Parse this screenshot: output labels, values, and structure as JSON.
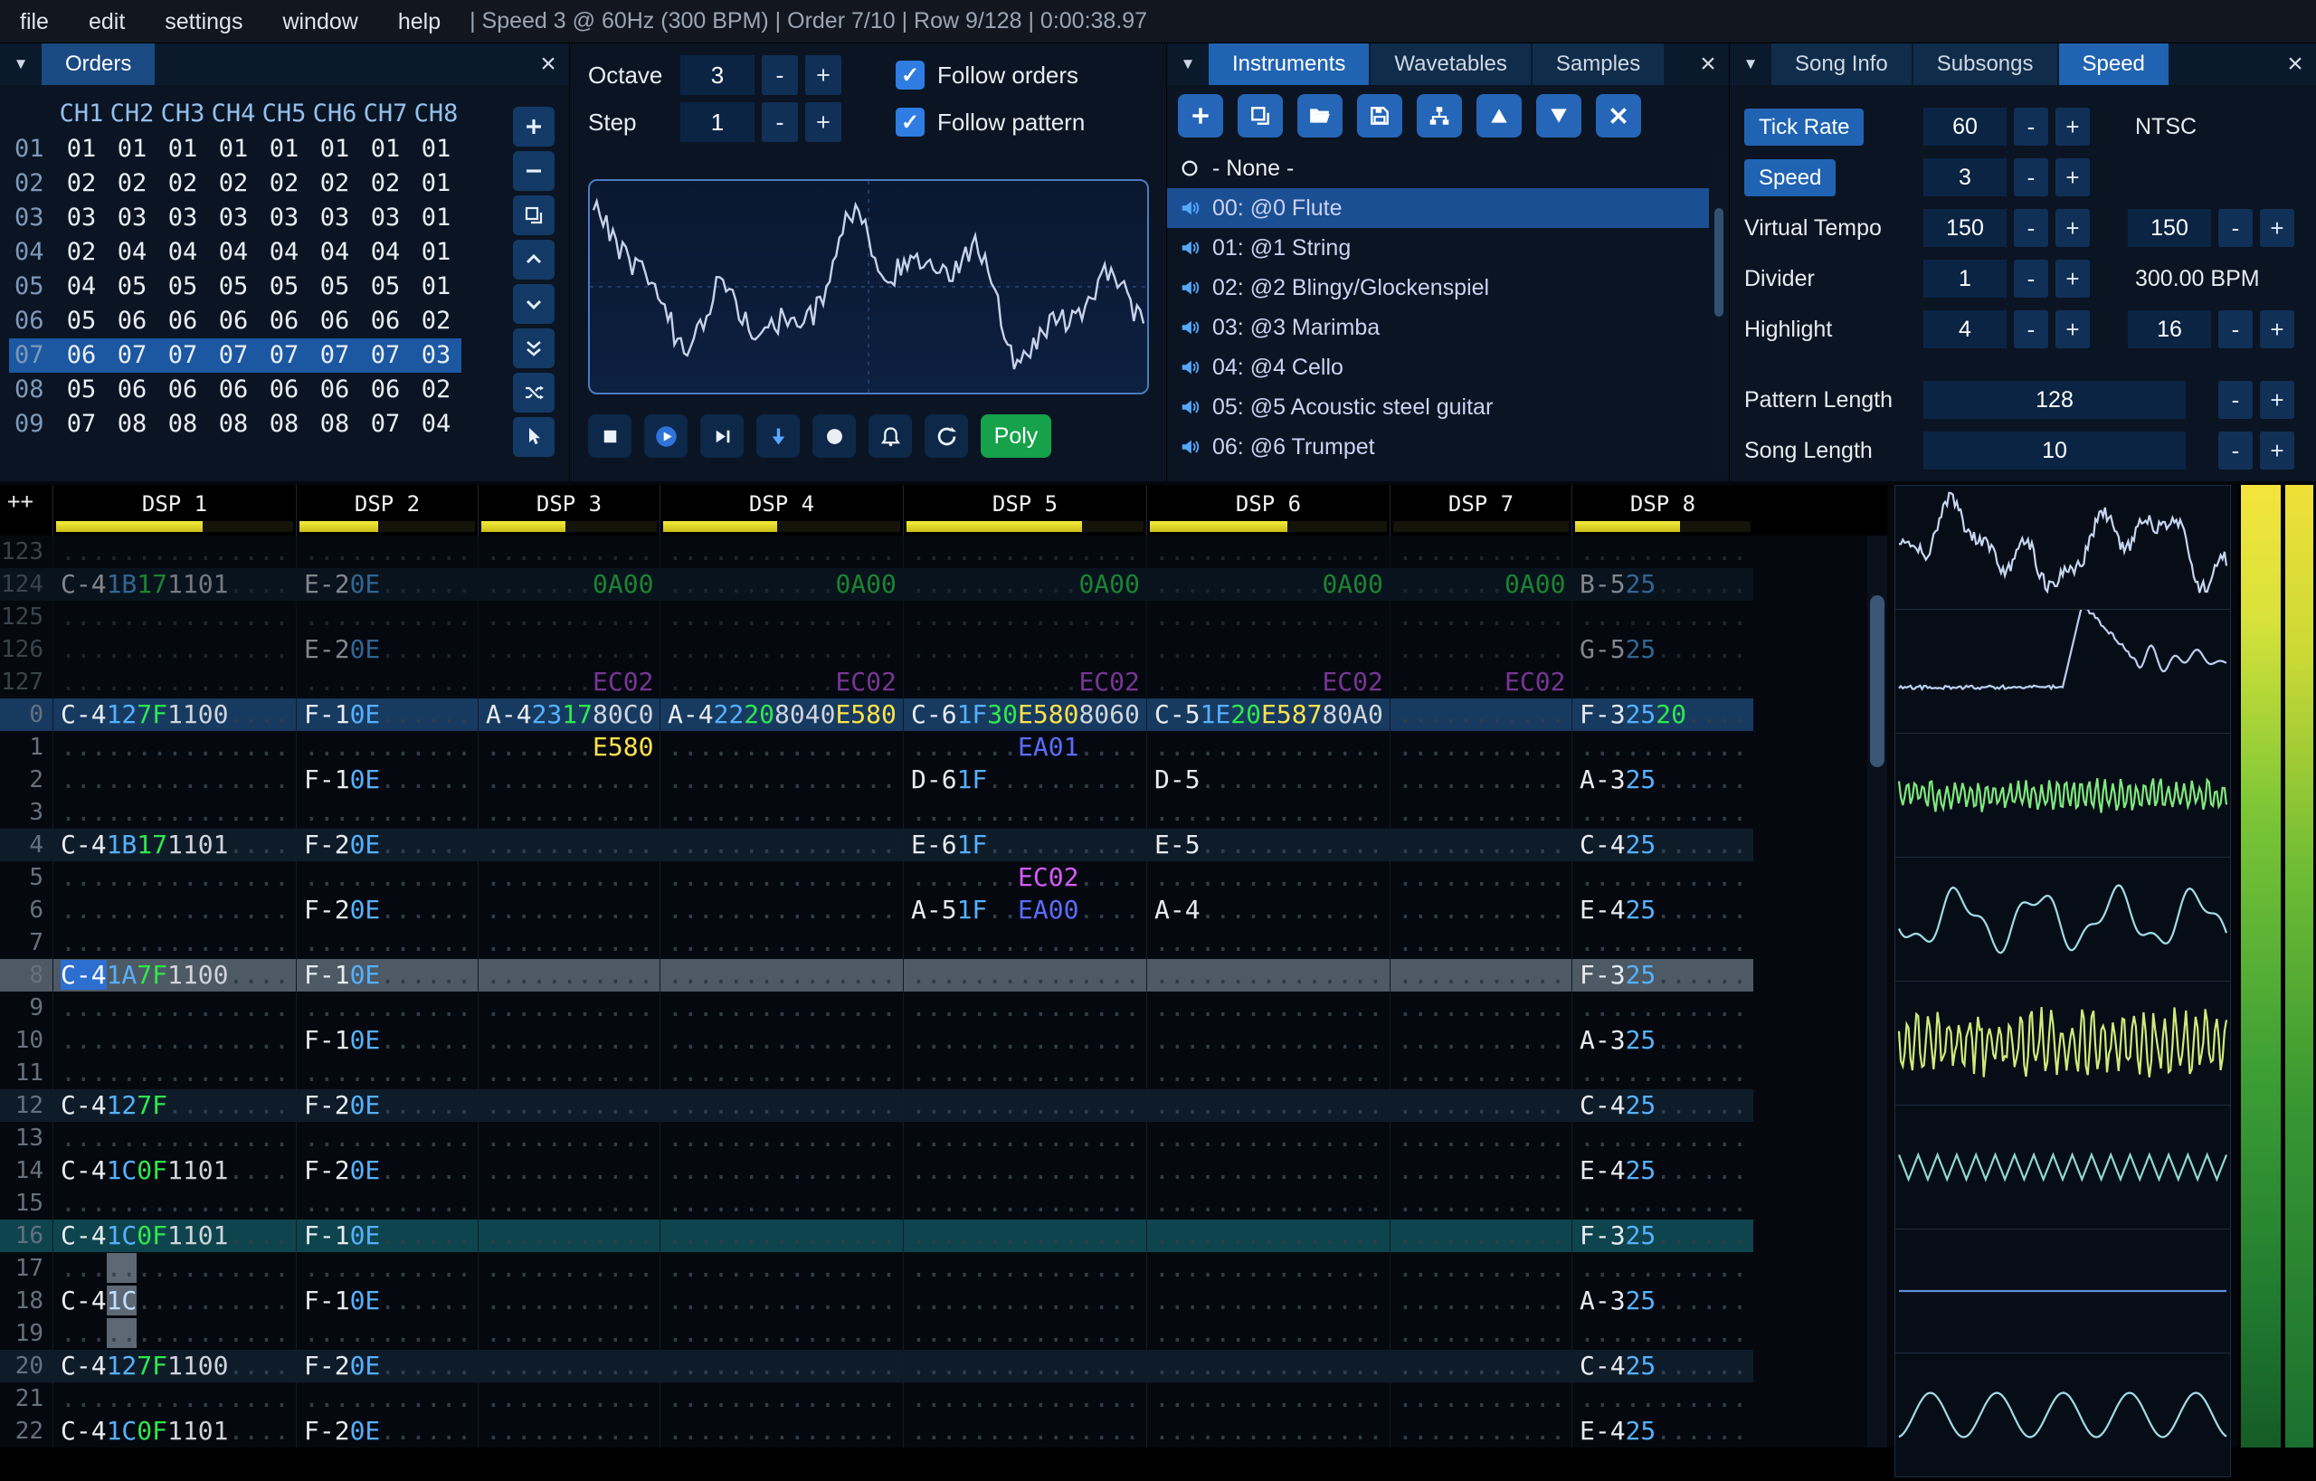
{
  "ui": {
    "collapse": "▼",
    "close": "×",
    "check": "✓"
  },
  "menu": {
    "items": [
      "file",
      "edit",
      "settings",
      "window",
      "help"
    ],
    "status": "| Speed 3 @ 60Hz (300 BPM) | Order 7/10 | Row 9/128 | 0:00:38.97"
  },
  "orders": {
    "title": "Orders",
    "columns": [
      "CH1",
      "CH2",
      "CH3",
      "CH4",
      "CH5",
      "CH6",
      "CH7",
      "CH8"
    ],
    "selected": 6,
    "rows": [
      {
        "num": "01",
        "vals": [
          "01",
          "01",
          "01",
          "01",
          "01",
          "01",
          "01",
          "01"
        ]
      },
      {
        "num": "02",
        "vals": [
          "02",
          "02",
          "02",
          "02",
          "02",
          "02",
          "02",
          "01"
        ]
      },
      {
        "num": "03",
        "vals": [
          "03",
          "03",
          "03",
          "03",
          "03",
          "03",
          "03",
          "01"
        ]
      },
      {
        "num": "04",
        "vals": [
          "02",
          "04",
          "04",
          "04",
          "04",
          "04",
          "04",
          "01"
        ]
      },
      {
        "num": "05",
        "vals": [
          "04",
          "05",
          "05",
          "05",
          "05",
          "05",
          "05",
          "01"
        ]
      },
      {
        "num": "06",
        "vals": [
          "05",
          "06",
          "06",
          "06",
          "06",
          "06",
          "06",
          "02"
        ]
      },
      {
        "num": "07",
        "vals": [
          "06",
          "07",
          "07",
          "07",
          "07",
          "07",
          "07",
          "03"
        ]
      },
      {
        "num": "08",
        "vals": [
          "05",
          "06",
          "06",
          "06",
          "06",
          "06",
          "06",
          "02"
        ]
      },
      {
        "num": "09",
        "vals": [
          "07",
          "08",
          "08",
          "08",
          "08",
          "08",
          "07",
          "04"
        ]
      }
    ],
    "toolbar": [
      "add",
      "remove",
      "duplicate",
      "move-up",
      "move-down",
      "duplicate-end",
      "random",
      "pointer"
    ]
  },
  "controls": {
    "octave_label": "Octave",
    "octave_value": "3",
    "step_label": "Step",
    "step_value": "1",
    "minus": "-",
    "plus": "+",
    "follow_orders": "Follow orders",
    "follow_pattern": "Follow pattern",
    "transport": [
      "stop",
      "play",
      "play-pattern",
      "step-down",
      "record",
      "metronome",
      "repeat"
    ],
    "poly_label": "Poly"
  },
  "oscilloscope": {
    "color": "#c6d2ea"
  },
  "instruments": {
    "tabs": [
      "Instruments",
      "Wavetables",
      "Samples"
    ],
    "active_tab": 0,
    "toolbar": [
      "add",
      "duplicate",
      "open",
      "save",
      "sitemap",
      "move-up-tri",
      "move-down-tri",
      "delete"
    ],
    "none_label": "- None -",
    "selected": 0,
    "items": [
      "00: @0 Flute",
      "01: @1 String",
      "02: @2 Blingy/Glockenspiel",
      "03: @3 Marimba",
      "04: @4 Cello",
      "05: @5 Acoustic steel guitar",
      "06: @6 Trumpet"
    ]
  },
  "song": {
    "tabs": [
      "Song Info",
      "Subsongs",
      "Speed"
    ],
    "active_tab": 2,
    "minus": "-",
    "plus": "+",
    "fields": [
      {
        "label": "Tick Rate",
        "button": true,
        "value": "60",
        "extra": "NTSC"
      },
      {
        "label": "Speed",
        "button": true,
        "value": "3"
      },
      {
        "label": "Virtual Tempo",
        "value": "150",
        "value2": "150"
      },
      {
        "label": "Divider",
        "value": "1",
        "extra": "300.00 BPM"
      },
      {
        "label": "Highlight",
        "value": "4",
        "value2": "16"
      },
      {
        "label": "Pattern Length",
        "value": "128",
        "wide": true
      },
      {
        "label": "Song Length",
        "value": "10",
        "wide": true
      }
    ]
  },
  "pattern": {
    "corner": "++",
    "channels": [
      {
        "name": "DSP 1",
        "meter": 62,
        "cols": [
          [
            "n",
            3
          ],
          [
            "i",
            2
          ],
          [
            "v",
            2
          ],
          [
            "f",
            4
          ],
          [
            "f",
            4
          ]
        ]
      },
      {
        "name": "DSP 2",
        "meter": 45,
        "cols": [
          [
            "n",
            3
          ],
          [
            "i",
            2
          ],
          [
            "v",
            2
          ],
          [
            "f",
            4
          ]
        ]
      },
      {
        "name": "DSP 3",
        "meter": 48,
        "cols": [
          [
            "n",
            3
          ],
          [
            "i",
            2
          ],
          [
            "v",
            2
          ],
          [
            "f",
            4
          ]
        ]
      },
      {
        "name": "DSP 4",
        "meter": 48,
        "cols": [
          [
            "n",
            3
          ],
          [
            "i",
            2
          ],
          [
            "v",
            2
          ],
          [
            "f",
            4
          ],
          [
            "f",
            4
          ]
        ]
      },
      {
        "name": "DSP 5",
        "meter": 74,
        "cols": [
          [
            "n",
            3
          ],
          [
            "i",
            2
          ],
          [
            "v",
            2
          ],
          [
            "f",
            4
          ],
          [
            "f",
            4
          ]
        ]
      },
      {
        "name": "DSP 6",
        "meter": 58,
        "cols": [
          [
            "n",
            3
          ],
          [
            "i",
            2
          ],
          [
            "v",
            2
          ],
          [
            "f",
            4
          ],
          [
            "f",
            4
          ]
        ]
      },
      {
        "name": "DSP 7",
        "meter": 0,
        "cols": [
          [
            "n",
            3
          ],
          [
            "i",
            2
          ],
          [
            "v",
            2
          ],
          [
            "f",
            4
          ]
        ]
      },
      {
        "name": "DSP 8",
        "meter": 60,
        "cols": [
          [
            "n",
            3
          ],
          [
            "i",
            2
          ],
          [
            "v",
            2
          ],
          [
            "f",
            4
          ]
        ]
      }
    ],
    "rows": [
      {
        "num": "123",
        "dim": true
      },
      {
        "num": "124",
        "dim": true,
        "hl": "h1",
        "cells": {
          "0": "C-4 1B 17 1101 -",
          "1": "E-2 0E - -",
          "2": "- - - g:0A00",
          "3": "- - - - g:0A00",
          "4": "- - - - g:0A00",
          "5": "- - - - g:0A00",
          "6": "- - - g:0A00",
          "7": "B-5 25 - -"
        }
      },
      {
        "num": "125",
        "dim": true
      },
      {
        "num": "126",
        "dim": true,
        "cells": {
          "1": "E-2 0E - -",
          "7": "G-5 25 - -"
        }
      },
      {
        "num": "127",
        "dim": true,
        "cells": {
          "2": "- - - p:EC02",
          "3": "- - - - p:EC02",
          "4": "- - - - p:EC02",
          "5": "- - - - p:EC02",
          "6": "- - - p:EC02"
        }
      },
      {
        "num": "0",
        "hl": "h2",
        "cells": {
          "0": "C-4 12 7F 1100 -",
          "1": "F-1 0E - -",
          "2": "A-4 23 17 80C0",
          "3": "A-4 22 20 8040 y:E580",
          "4": "C-6 1F 30 y:E580 8060",
          "5": "C-5 1E 20 y:E587 80A0",
          "7": "F-3 25 20 -"
        }
      },
      {
        "num": "1",
        "cells": {
          "2": "- - - y:E580",
          "4": "- - - b:EA01 -"
        }
      },
      {
        "num": "2",
        "cells": {
          "1": "F-1 0E - -",
          "4": "D-6 1F - - -",
          "5": "D-5 - - - -",
          "7": "A-3 25 - -"
        }
      },
      {
        "num": "3"
      },
      {
        "num": "4",
        "hl": "h1",
        "cells": {
          "0": "C-4 1B 17 1101 -",
          "1": "F-2 0E - -",
          "4": "E-6 1F - - -",
          "5": "E-5 - - - -",
          "7": "C-4 25 - -"
        }
      },
      {
        "num": "5",
        "cells": {
          "4": "- - - p:EC02 -"
        }
      },
      {
        "num": "6",
        "cells": {
          "1": "F-2 0E - -",
          "4": "A-5 1F - b:EA00 -",
          "5": "A-4 - - - -",
          "7": "E-4 25 - -"
        }
      },
      {
        "num": "7"
      },
      {
        "num": "8",
        "hl": "cur",
        "cells": {
          "0": "c:C-4 1A 7F 1100 -",
          "1": "F-1 0E - -",
          "7": "F-3 25 - -"
        }
      },
      {
        "num": "9"
      },
      {
        "num": "10",
        "cells": {
          "1": "F-1 0E - -",
          "7": "A-3 25 - -"
        }
      },
      {
        "num": "11"
      },
      {
        "num": "12",
        "hl": "h1",
        "cells": {
          "0": "C-4 12 7F - -",
          "1": "F-2 0E - -",
          "7": "C-4 25 - -"
        }
      },
      {
        "num": "13"
      },
      {
        "num": "14",
        "cells": {
          "0": "C-4 1C 0F 1101 -",
          "1": "F-2 0E - -",
          "7": "E-4 25 - -"
        }
      },
      {
        "num": "15"
      },
      {
        "num": "16",
        "hl": "h2b",
        "cells": {
          "0": "C-4 1C 0F 1101 -",
          "1": "F-1 0E - -",
          "7": "F-3 25 - -"
        }
      },
      {
        "num": "17",
        "cells": {
          "0": "- s:.. - - -"
        }
      },
      {
        "num": "18",
        "cells": {
          "0": "C-4 si:1C - - -",
          "1": "F-1 0E - -",
          "7": "A-3 25 - -"
        }
      },
      {
        "num": "19",
        "cells": {
          "0": "- s:.. - - -"
        }
      },
      {
        "num": "20",
        "hl": "h1",
        "cells": {
          "0": "C-4 12 7F 1100 -",
          "1": "F-2 0E - -",
          "7": "C-4 25 - -"
        }
      },
      {
        "num": "21"
      },
      {
        "num": "22",
        "cells": {
          "0": "C-4 1C 0F 1101 -",
          "1": "F-2 0E - -",
          "7": "E-4 25 - -"
        }
      }
    ]
  },
  "scopes": [
    {
      "type": "smooth",
      "color": "#c6d6f2"
    },
    {
      "type": "pulse",
      "color": "#b9cdf0"
    },
    {
      "type": "dense",
      "color": "#7fe87f"
    },
    {
      "type": "wave",
      "color": "#9fdce8"
    },
    {
      "type": "denselarge",
      "color": "#cdeb7a"
    },
    {
      "type": "zigzag",
      "color": "#8fd8cc"
    },
    {
      "type": "flat",
      "color": "#5f8fd8"
    },
    {
      "type": "sine",
      "color": "#9fdce8"
    }
  ]
}
